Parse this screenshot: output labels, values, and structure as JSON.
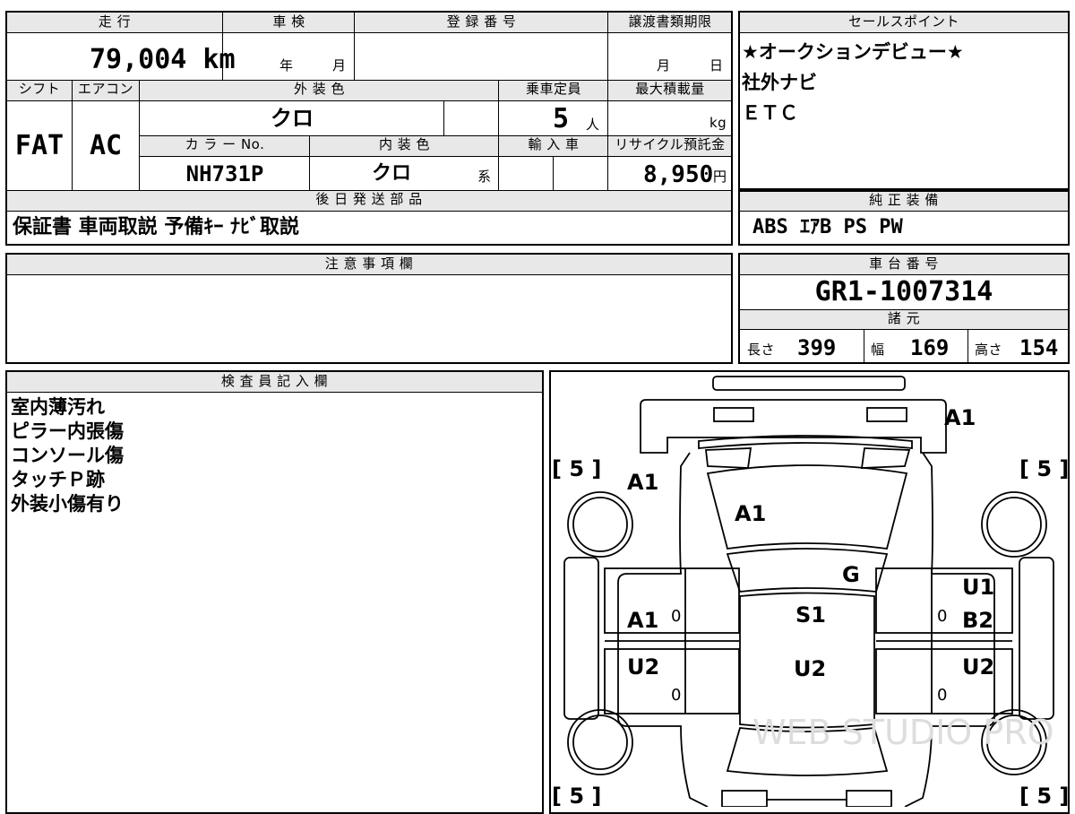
{
  "top_info": {
    "mileage_header": "走 行",
    "mileage_value": "79,004 km",
    "shaken_header": "車 検",
    "shaken_year_unit": "年",
    "shaken_month_unit": "月",
    "registration_header": "登 録 番 号",
    "transfer_header": "譲渡書類期限",
    "transfer_month_unit": "月",
    "transfer_day_unit": "日",
    "shift_header": "シフト",
    "shift_value": "FAT",
    "ac_header": "エアコン",
    "ac_value": "AC",
    "exterior_color_header": "外 装 色",
    "exterior_color_value": "クロ",
    "capacity_header": "乗車定員",
    "capacity_value": "5",
    "capacity_unit": "人",
    "max_load_header": "最大積載量",
    "max_load_unit": "kg",
    "color_no_header": "カ ラ ー No.",
    "color_no_value": "NH731P",
    "interior_color_header": "内 装 色",
    "interior_color_value": "クロ",
    "interior_color_suffix": "系",
    "import_header": "輸 入 車",
    "recycle_header": "リサイクル預託金",
    "recycle_value": "8,950",
    "recycle_unit": "円",
    "later_parts_header": "後 日 発 送 部 品",
    "later_parts_value": "保証書 車両取説 予備ｷｰ ﾅﾋﾞ取説"
  },
  "sales_points": {
    "header": "セールスポイント",
    "lines": [
      "★オークションデビュー★",
      "社外ナビ",
      "ＥＴＣ"
    ]
  },
  "genuine_equipment": {
    "header": "純 正 装 備",
    "value": "ABS ｴｱB PS PW"
  },
  "notes": {
    "header": "注 意 事 項 欄",
    "value": ""
  },
  "chassis": {
    "header": "車 台 番 号",
    "value": "GR1-1007314"
  },
  "specs": {
    "header": "諸 元",
    "length_label": "長さ",
    "length_value": "399",
    "width_label": "幅",
    "width_value": "169",
    "height_label": "高さ",
    "height_value": "154"
  },
  "inspector": {
    "header": "検 査 員 記 入 欄",
    "lines": [
      "室内薄汚れ",
      "ピラー内張傷",
      "コンソール傷",
      "タッチＰ跡",
      "外装小傷有り"
    ]
  },
  "diagram": {
    "tire_fl": "[ 5 ]",
    "tire_fr": "[ 5 ]",
    "tire_rl": "[ 5 ]",
    "tire_rr": "[ 5 ]",
    "front_bumper": "A1",
    "left_fender": "A1",
    "hood": "A1",
    "windshield": "G",
    "right_fender": "U1",
    "left_front_door": "A1",
    "roof": "S1",
    "right_front_door": "B2",
    "left_rear_door": "U2",
    "roof_rear": "U2",
    "right_rear_door": "U2",
    "zero_1": "0",
    "zero_2": "0",
    "zero_3": "0",
    "zero_4": "0",
    "watermark": "WEB STUDIO PRO"
  }
}
